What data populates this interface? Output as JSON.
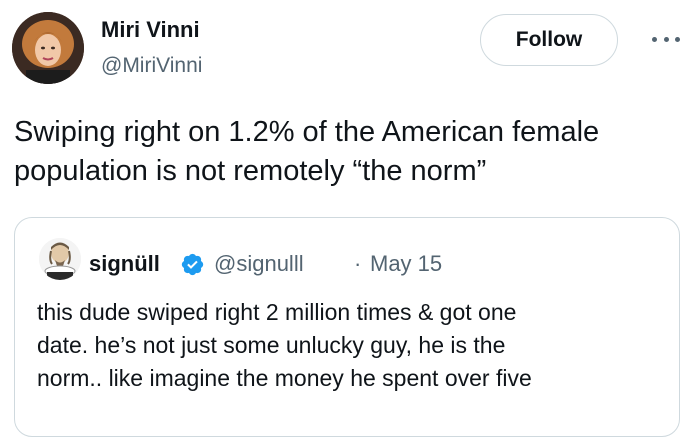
{
  "author": {
    "name": "Miri Vinni",
    "handle": "@MiriVinni",
    "avatar_icon": "profile-photo-icon"
  },
  "follow_label": "Follow",
  "more_icon": "more-horizontal-icon",
  "tweet_text": "Swiping right on 1.2% of the American female population is not remotely “the norm”",
  "quoted_tweet": {
    "name": "signüll",
    "verified": true,
    "verified_color": "#1d9bf0",
    "handle": "@signulll",
    "separator": "·",
    "date": "May 15",
    "text_lines": [
      "this dude swiped right 2 million times & got one",
      "date. he’s not just some unlucky guy, he is the",
      "norm.. like imagine the money he spent over five"
    ]
  },
  "colors": {
    "text_primary": "#0f1419",
    "text_secondary": "#536471",
    "border": "#cfd9de"
  }
}
